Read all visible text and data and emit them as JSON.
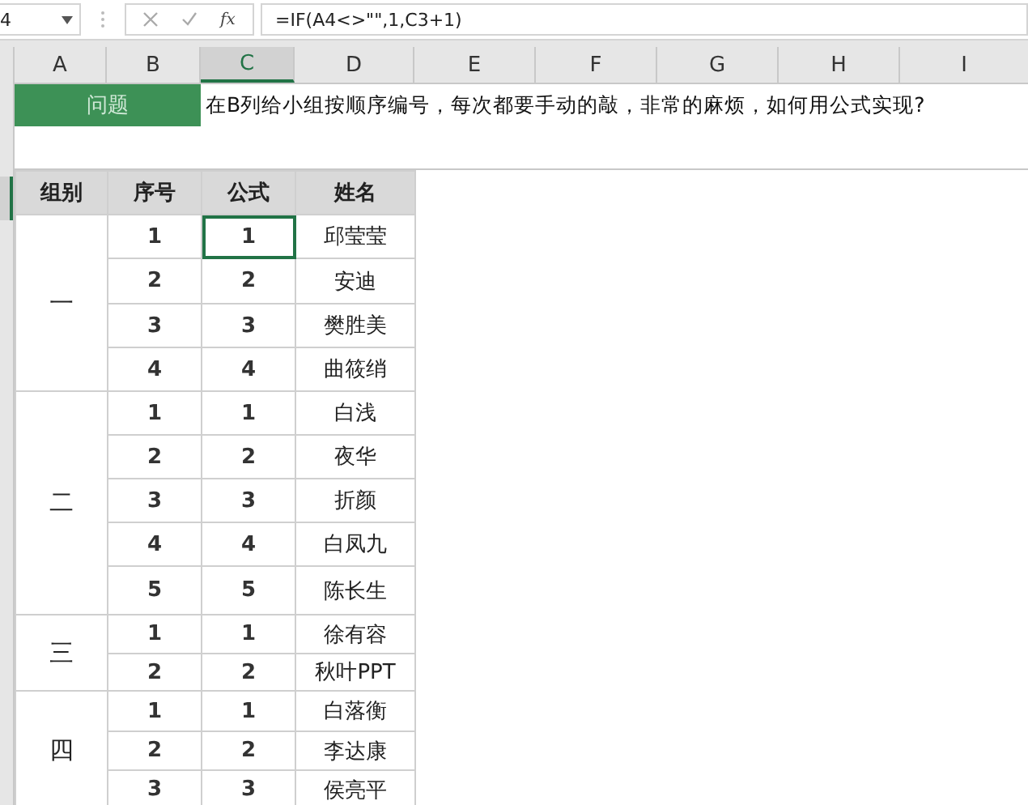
{
  "name_box": "4",
  "function_label": "fx",
  "formula": "=IF(A4<>\"\",1,C3+1)",
  "columns": [
    {
      "label": "A",
      "selected": false
    },
    {
      "label": "B",
      "selected": false
    },
    {
      "label": "C",
      "selected": true
    },
    {
      "label": "D",
      "selected": false
    },
    {
      "label": "E",
      "selected": false
    },
    {
      "label": "F",
      "selected": false
    },
    {
      "label": "G",
      "selected": false
    },
    {
      "label": "H",
      "selected": false
    },
    {
      "label": "I",
      "selected": false
    }
  ],
  "question": {
    "label": "问题",
    "text": "在B列给小组按顺序编号，每次都要手动的敲，非常的麻烦，如何用公式实现?"
  },
  "table": {
    "headers": [
      "组别",
      "序号",
      "公式",
      "姓名"
    ],
    "groups": [
      {
        "name": "一",
        "rows": [
          {
            "seq": "1",
            "formula": "1",
            "name": "邱莹莹",
            "selected": true
          },
          {
            "seq": "2",
            "formula": "2",
            "name": "安迪",
            "selected": false
          },
          {
            "seq": "3",
            "formula": "3",
            "name": "樊胜美",
            "selected": false
          },
          {
            "seq": "4",
            "formula": "4",
            "name": "曲筱绡",
            "selected": false
          }
        ]
      },
      {
        "name": "二",
        "rows": [
          {
            "seq": "1",
            "formula": "1",
            "name": "白浅",
            "selected": false
          },
          {
            "seq": "2",
            "formula": "2",
            "name": "夜华",
            "selected": false
          },
          {
            "seq": "3",
            "formula": "3",
            "name": "折颜",
            "selected": false
          },
          {
            "seq": "4",
            "formula": "4",
            "name": "白凤九",
            "selected": false
          },
          {
            "seq": "5",
            "formula": "5",
            "name": "陈长生",
            "selected": false
          }
        ]
      },
      {
        "name": "三",
        "rows": [
          {
            "seq": "1",
            "formula": "1",
            "name": "徐有容",
            "selected": false
          },
          {
            "seq": "2",
            "formula": "2",
            "name": "秋叶PPT",
            "selected": false
          }
        ]
      },
      {
        "name": "四",
        "rows": [
          {
            "seq": "1",
            "formula": "1",
            "name": "白落衡",
            "selected": false
          },
          {
            "seq": "2",
            "formula": "2",
            "name": "李达康",
            "selected": false
          },
          {
            "seq": "3",
            "formula": "3",
            "name": "侯亮平",
            "selected": false
          }
        ]
      }
    ]
  }
}
